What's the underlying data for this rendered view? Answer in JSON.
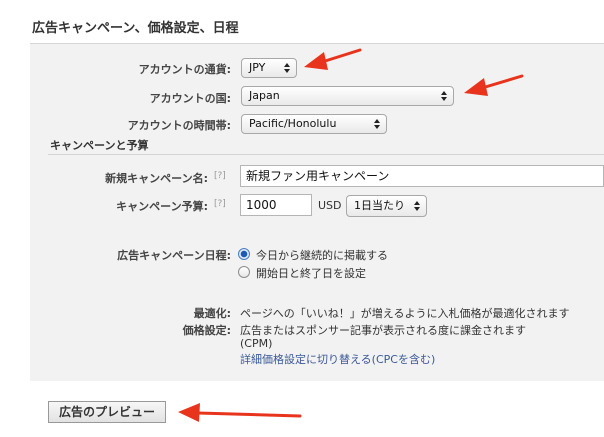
{
  "section_title": "広告キャンペーン、価格設定、日程",
  "account": {
    "currency_label": "アカウントの通貨:",
    "currency_value": "JPY",
    "country_label": "アカウントの国:",
    "country_value": "Japan",
    "timezone_label": "アカウントの時間帯:",
    "timezone_value": "Pacific/Honolulu"
  },
  "campaign": {
    "heading": "キャンペーンと予算",
    "name_label": "新規キャンペーン名:",
    "name_value": "新規ファン用キャンペーン",
    "budget_label": "キャンペーン予算:",
    "budget_value": "1000",
    "budget_currency": "USD",
    "budget_period": "1日当たり",
    "help_marker": "[?]"
  },
  "schedule": {
    "label": "広告キャンペーン日程:",
    "option_continuous": "今日から継続的に掲載する",
    "option_range": "開始日と終了日を設定",
    "selected": "continuous"
  },
  "pricing": {
    "optimize_label": "最適化:",
    "optimize_text": "ページへの「いいね！」が増えるように入札価格が最適化されます",
    "price_label": "価格設定:",
    "price_text": "広告またはスポンサー記事が表示される度に課金されます",
    "price_unit": "(CPM)",
    "switch_link": "詳細価格設定に切り替える(CPCを含む)"
  },
  "preview_button": "広告のプレビュー",
  "annotation_color": "#e8341c"
}
